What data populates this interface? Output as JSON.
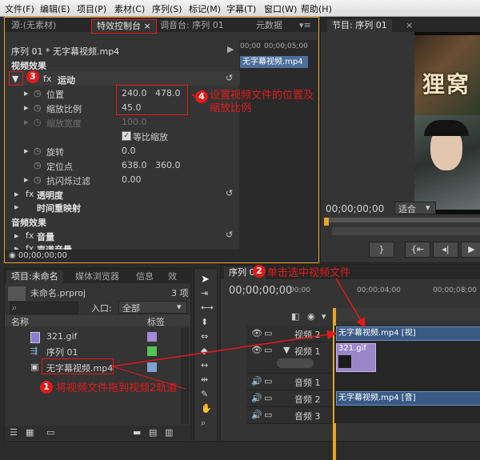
{
  "menu": [
    "文件(F)",
    "编辑(E)",
    "项目(P)",
    "素材(C)",
    "序列(S)",
    "标记(M)",
    "字幕(T)",
    "窗口(W)",
    "帮助(H)"
  ],
  "effects_panel": {
    "tabs": [
      "源:(无素材)",
      "特效控制台",
      "调音台: 序列 01",
      "元数据"
    ],
    "clip_title": "序列 01 * 无字幕视频.mp4",
    "timecode_top": "00;00",
    "timecode_top2": "00;00;05;00",
    "clip_chip": "无字幕视频.mp4",
    "section_video": "视频效果",
    "motion": "运动",
    "position": {
      "label": "位置",
      "x": "240.0",
      "y": "478.0"
    },
    "scale": {
      "label": "缩放比例",
      "value": "45.0"
    },
    "scale_width": {
      "label": "缩放宽度",
      "value": "100.0"
    },
    "uniform_scale": "等比缩放",
    "rotation": {
      "label": "旋转",
      "value": "0.0"
    },
    "anchor": {
      "label": "定位点",
      "x": "638.0",
      "y": "360.0"
    },
    "antiflicker": {
      "label": "抗闪烁过滤",
      "value": "0.00"
    },
    "opacity": "透明度",
    "time_remap": "时间重映射",
    "section_audio": "音频效果",
    "volume": "音量",
    "channel_volume": "声道音量",
    "timecode_bottom": "00;00;00;00"
  },
  "program_monitor": {
    "tab": "节目: 序列 01",
    "overlay_text": "狸窝",
    "timecode": "00;00;00;00",
    "fit": "适合"
  },
  "project_panel": {
    "tabs": [
      "项目:未命名",
      "媒体浏览器",
      "信息",
      "效"
    ],
    "project_file": "未命名.prproj",
    "item_count": "3 项",
    "entry_label": "入口:",
    "entry_value": "全部",
    "col_name": "名称",
    "col_label": "标签",
    "items": [
      {
        "name": "321.gif",
        "color": "#a58bd6"
      },
      {
        "name": "序列 01",
        "color": "#55c455"
      },
      {
        "name": "无字幕视频.mp4",
        "color": "#7fa2d2"
      }
    ]
  },
  "timeline": {
    "tab": "序列 01",
    "timecode": "00;00;00;00",
    "ruler": [
      "00;00",
      "00;00;04;00",
      "00;00;08;00"
    ],
    "tracks": [
      "视频 2",
      "视频 1",
      "音频 1",
      "音频 2",
      "音频 3"
    ],
    "clip_v2": "无字幕视频.mp4 [视]",
    "clip_v1": "321.gif",
    "clip_a2": "无字幕视频.mp4 [音]"
  },
  "annotations": {
    "n1": "1",
    "t1": "将视频文件拖到视频2轨道",
    "n2": "2",
    "t2": "单击选中视频文件",
    "n3": "3",
    "n4": "4",
    "t4a": "设置视频文件的位置及",
    "t4b": "缩放比例"
  },
  "colors": {
    "accent": "#e8a526",
    "annotation": "#e21a1a",
    "clip_video": "#3a5a85",
    "clip_gif": "#9b86c8"
  }
}
